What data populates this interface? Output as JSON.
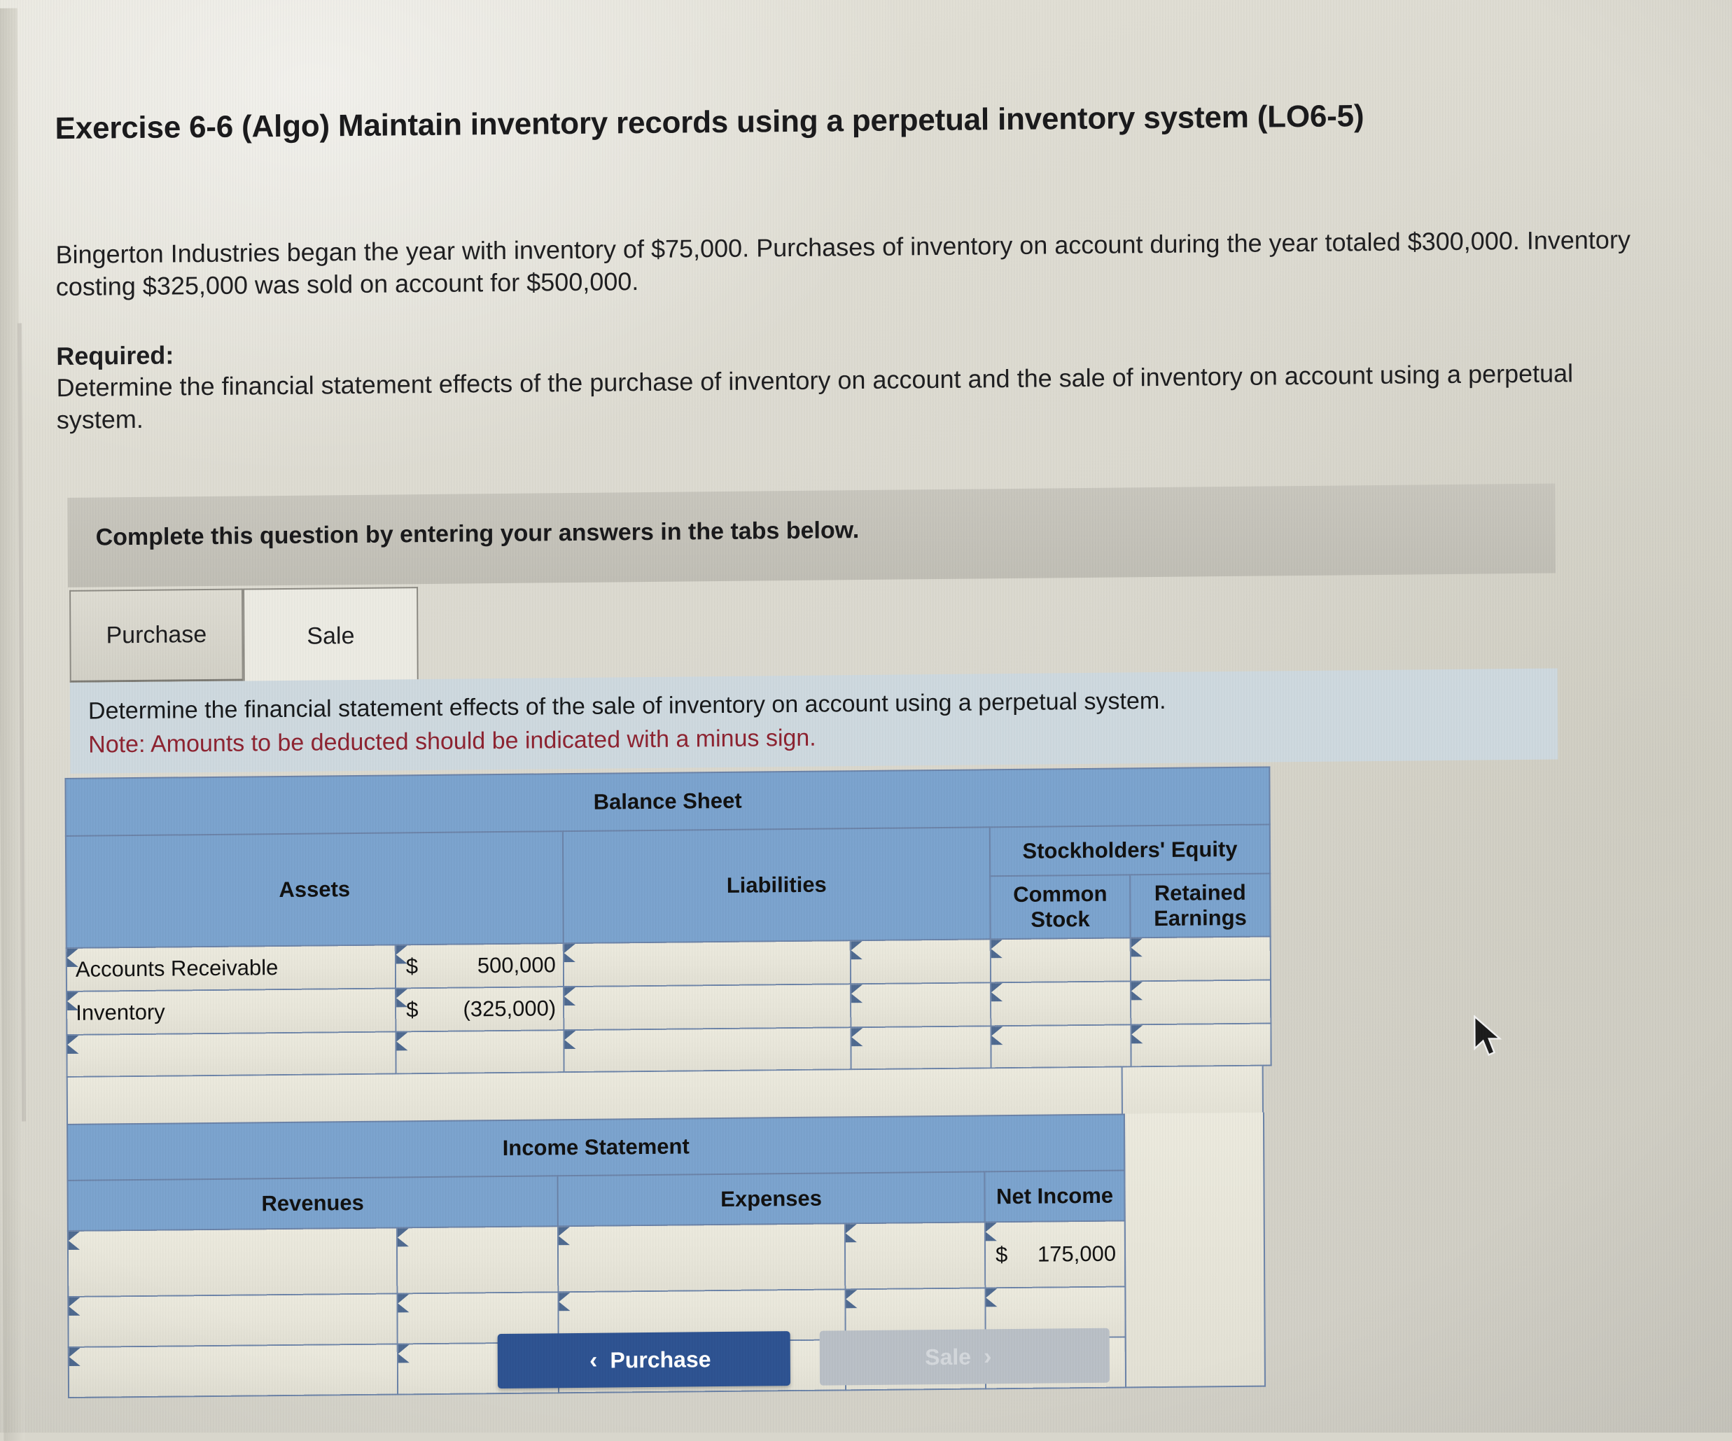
{
  "exercise": {
    "title": "Exercise 6-6 (Algo) Maintain inventory records using a perpetual inventory system (LO6-5)",
    "intro": "Bingerton Industries began the year with inventory of $75,000. Purchases of inventory on account during the year totaled $300,000. Inventory costing $325,000 was sold on account for $500,000.",
    "required_label": "Required:",
    "required_body": "Determine the financial statement effects of the purchase of inventory on account and the sale of inventory on account using a perpetual system."
  },
  "complete_bar": {
    "text": "Complete this question by entering your answers in the tabs below."
  },
  "tabs": [
    {
      "label": "Purchase",
      "active": false
    },
    {
      "label": "Sale",
      "active": true
    }
  ],
  "note_panel": {
    "instruction": "Determine the financial statement effects of the sale of inventory on account using a perpetual system.",
    "note": "Note: Amounts to be deducted should be indicated with a minus sign."
  },
  "balance_sheet": {
    "title": "Balance Sheet",
    "groups": {
      "assets": "Assets",
      "liabilities": "Liabilities",
      "stockholders_equity": "Stockholders' Equity"
    },
    "subcolumns": {
      "common_stock": "Common Stock",
      "retained_earnings": "Retained Earnings"
    },
    "rows": [
      {
        "asset_label": "Accounts Receivable",
        "asset_dollar": "$",
        "asset_amount": "500,000",
        "liability_label": "",
        "liability_amount": "",
        "common_stock": "",
        "retained_earnings": ""
      },
      {
        "asset_label": "Inventory",
        "asset_dollar": "$",
        "asset_amount": "(325,000)",
        "liability_label": "",
        "liability_amount": "",
        "common_stock": "",
        "retained_earnings": ""
      },
      {
        "asset_label": "",
        "asset_dollar": "",
        "asset_amount": "",
        "liability_label": "",
        "liability_amount": "",
        "common_stock": "",
        "retained_earnings": ""
      }
    ]
  },
  "income_statement": {
    "title": "Income Statement",
    "columns": {
      "revenues": "Revenues",
      "expenses": "Expenses",
      "net_income": "Net Income"
    },
    "rows": [
      {
        "revenue_label": "",
        "revenue_amount": "",
        "expense_label": "",
        "expense_amount": "",
        "net_income_dollar": "$",
        "net_income_amount": "175,000"
      },
      {
        "revenue_label": "",
        "revenue_amount": "",
        "expense_label": "",
        "expense_amount": "",
        "net_income_dollar": "",
        "net_income_amount": ""
      },
      {
        "revenue_label": "",
        "revenue_amount": "",
        "expense_label": "",
        "expense_amount": "",
        "net_income_dollar": "",
        "net_income_amount": ""
      }
    ]
  },
  "nav": {
    "prev_label": "Purchase",
    "prev_chevron": "‹",
    "next_label": "Sale",
    "next_chevron": "›"
  },
  "colors": {
    "header_blue": "#7ba3ce",
    "grid_border": "#6b83a8",
    "note_panel_bg": "#ced9df",
    "note_red": "#8d2230",
    "primary_button": "#2d5291",
    "disabled_button": "#b9bfc6",
    "page_bg": "#dedcd2"
  }
}
